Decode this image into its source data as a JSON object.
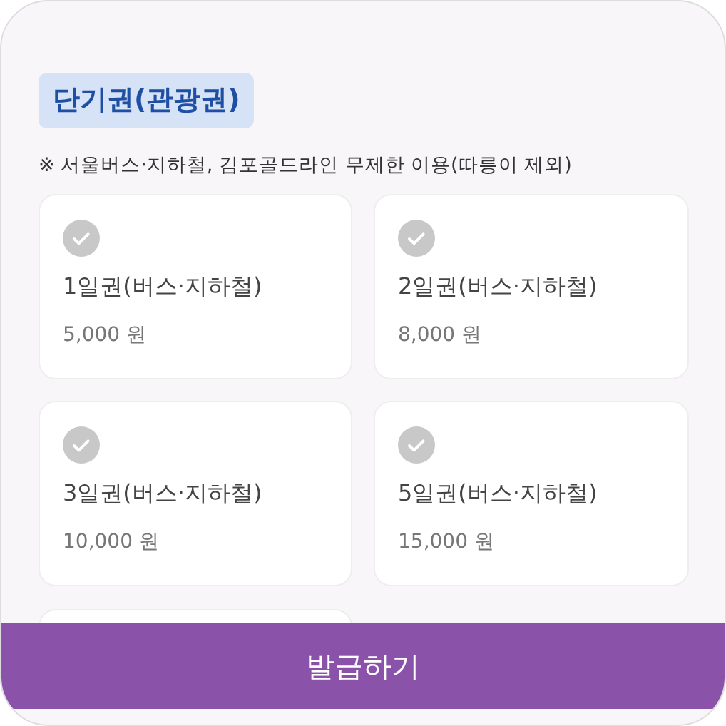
{
  "section_tag": "단기권(관광권)",
  "note": "※ 서울버스·지하철, 김포골드라인 무제한 이용(따릉이 제외)",
  "passes": [
    {
      "name": "1일권(버스·지하철)",
      "price": "5,000 원",
      "selected": false
    },
    {
      "name": "2일권(버스·지하철)",
      "price": "8,000 원",
      "selected": false
    },
    {
      "name": "3일권(버스·지하철)",
      "price": "10,000 원",
      "selected": false
    },
    {
      "name": "5일권(버스·지하철)",
      "price": "15,000 원",
      "selected": false
    }
  ],
  "issue_button": "발급하기"
}
